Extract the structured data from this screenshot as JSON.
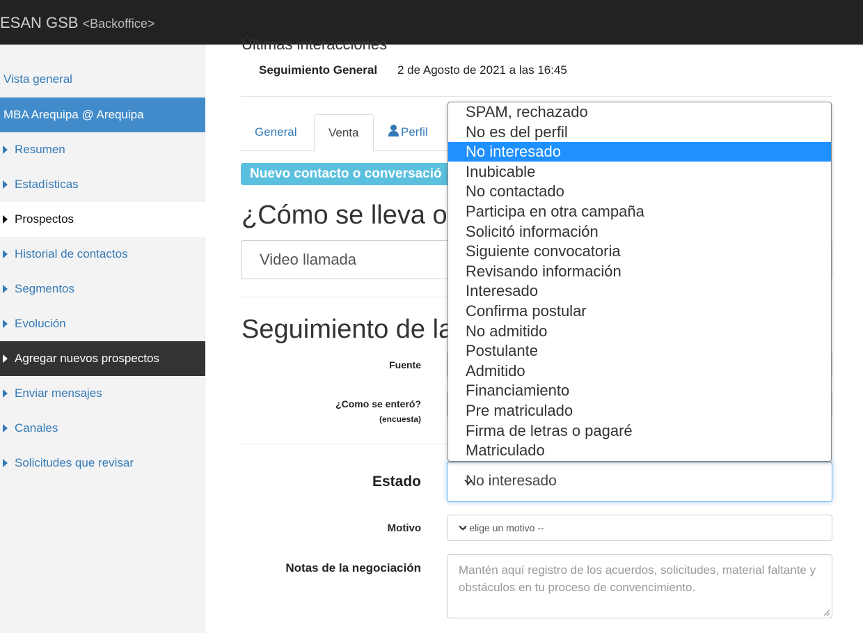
{
  "header": {
    "brand": "ESAN GSB",
    "brand_sub": "<Backoffice>"
  },
  "sidebar": {
    "items": [
      {
        "label": "Vista general"
      },
      {
        "label": "MBA Arequipa @ Arequipa"
      },
      {
        "label": "Resumen"
      },
      {
        "label": "Estadísticas"
      },
      {
        "label": "Prospectos"
      },
      {
        "label": "Historial de contactos"
      },
      {
        "label": "Segmentos"
      },
      {
        "label": "Evolución"
      },
      {
        "label": "Agregar nuevos prospectos"
      },
      {
        "label": "Enviar mensajes"
      },
      {
        "label": "Canales"
      },
      {
        "label": "Solicitudes que revisar"
      }
    ]
  },
  "main": {
    "partial_heading": "Últimas interacciones",
    "interaction": {
      "label": "Seguimiento General",
      "value": "2 de Agosto de 2021 a las 16:45"
    },
    "tabs": [
      {
        "label": "General"
      },
      {
        "label": "Venta"
      },
      {
        "label": "Perfil"
      }
    ],
    "info_label": "Nuevo contacto o conversació",
    "como_heading": "¿Cómo se lleva o",
    "channel_value": "Video llamada",
    "seguimiento_heading": "Seguimiento de la",
    "form": {
      "fuente_label": "Fuente",
      "como_label": "¿Como se enteró?",
      "encuesta_label": "(encuesta)",
      "estado_label": "Estado",
      "estado_value": "No interesado",
      "motivo_label": "Motivo",
      "motivo_value": "-- elige un motivo --",
      "notas_label": "Notas de la negociación",
      "notas_placeholder": "Mantén aquí registro de los acuerdos, solicitudes, material faltante y obstáculos en tu proceso de convencimiento."
    }
  },
  "dropdown": {
    "selected": "No interesado",
    "options": [
      "SPAM, rechazado",
      "No es del perfil",
      "No interesado",
      "Inubicable",
      "No contactado",
      "Participa en otra campaña",
      "Solicitó información",
      "Siguiente convocatoria",
      "Revisando información",
      "Interesado",
      "Confirma postular",
      "No admitido",
      "Postulante",
      "Admitido",
      "Financiamiento",
      "Pre matriculado",
      "Firma de letras o pagaré",
      "Matriculado"
    ]
  },
  "colors": {
    "navbar": "#222222",
    "sidebar_active": "#428bca",
    "sidebar_dark": "#333333",
    "link": "#337ab7",
    "info_label": "#5bc0de",
    "option_selected": "#1e90ff"
  }
}
